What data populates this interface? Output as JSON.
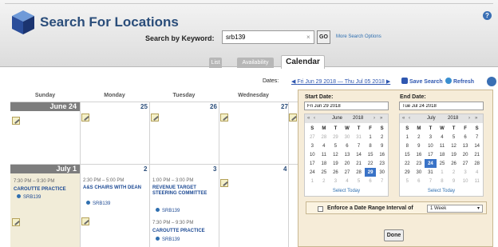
{
  "header": {
    "title": "Search For Locations",
    "keyword_label": "Search by Keyword:",
    "keyword_value": "srb139",
    "clear_glyph": "×",
    "go_label": "GO",
    "more_options": "More Search Options"
  },
  "tabs": {
    "list": "List",
    "availability": "Availability",
    "calendar": "Calendar"
  },
  "toolbar": {
    "dates_label": "Dates:",
    "date_range": "Fri Jun 29 2018 — Thu Jul 05 2018",
    "save_search": "Save Search",
    "refresh": "Refresh"
  },
  "calendar": {
    "days": [
      "Sunday",
      "Monday",
      "Tuesday",
      "Wednesday"
    ],
    "week1": {
      "sun_label": "June 24",
      "mon": "25",
      "tue": "26",
      "wed": "27"
    },
    "week2": {
      "sun_label": "July 1",
      "mon": "2",
      "tue": "3",
      "wed": "4"
    },
    "events": {
      "sun1_time": "7:30 PM – 9:30 PM",
      "sun1_title": "CAROUTTE PRACTICE",
      "sun1_loc": "SRB139",
      "mon1_time": "2:30 PM – 5:00 PM",
      "mon1_title": "A&S CHAIRS WITH DEAN",
      "mon1_loc": "SRB139",
      "tue1_time": "1:00 PM – 3:00 PM",
      "tue1_title": "REVENUE TARGET STEERING COMMITTEE",
      "tue1_loc": "SRB139",
      "tue2_time": "7:30 PM – 9:30 PM",
      "tue2_title": "CAROUTTE PRACTICE",
      "tue2_loc": "SRB139"
    }
  },
  "popup": {
    "start_label": "Start Date:",
    "start_value": "Fri Jun 29 2018",
    "end_label": "End Date:",
    "end_value": "Tue Jul 24 2018",
    "start_month": "June",
    "start_year": "2018",
    "end_month": "July",
    "end_year": "2018",
    "weekdays": [
      "S",
      "M",
      "T",
      "W",
      "T",
      "F",
      "S"
    ],
    "start_weeks": [
      [
        "27",
        "28",
        "29",
        "30",
        "31",
        "1",
        "2"
      ],
      [
        "3",
        "4",
        "5",
        "6",
        "7",
        "8",
        "9"
      ],
      [
        "10",
        "11",
        "12",
        "13",
        "14",
        "15",
        "16"
      ],
      [
        "17",
        "18",
        "19",
        "20",
        "21",
        "22",
        "23"
      ],
      [
        "24",
        "25",
        "26",
        "27",
        "28",
        "29",
        "30"
      ],
      [
        "1",
        "2",
        "3",
        "4",
        "5",
        "6",
        "7"
      ]
    ],
    "end_weeks": [
      [
        "1",
        "2",
        "3",
        "4",
        "5",
        "6",
        "7"
      ],
      [
        "8",
        "9",
        "10",
        "11",
        "12",
        "13",
        "14"
      ],
      [
        "15",
        "16",
        "17",
        "18",
        "19",
        "20",
        "21"
      ],
      [
        "22",
        "23",
        "24",
        "25",
        "26",
        "27",
        "28"
      ],
      [
        "29",
        "30",
        "31",
        "1",
        "2",
        "3",
        "4"
      ],
      [
        "5",
        "6",
        "7",
        "8",
        "9",
        "10",
        "11"
      ]
    ],
    "select_today": "Select Today",
    "enforce_label": "Enforce a Date Range Interval of",
    "interval_value": "1 Week",
    "done": "Done"
  },
  "colors": {
    "accent": "#3a73c7",
    "brand": "#2a4d7a",
    "popup_bg": "#f6ecd8"
  }
}
